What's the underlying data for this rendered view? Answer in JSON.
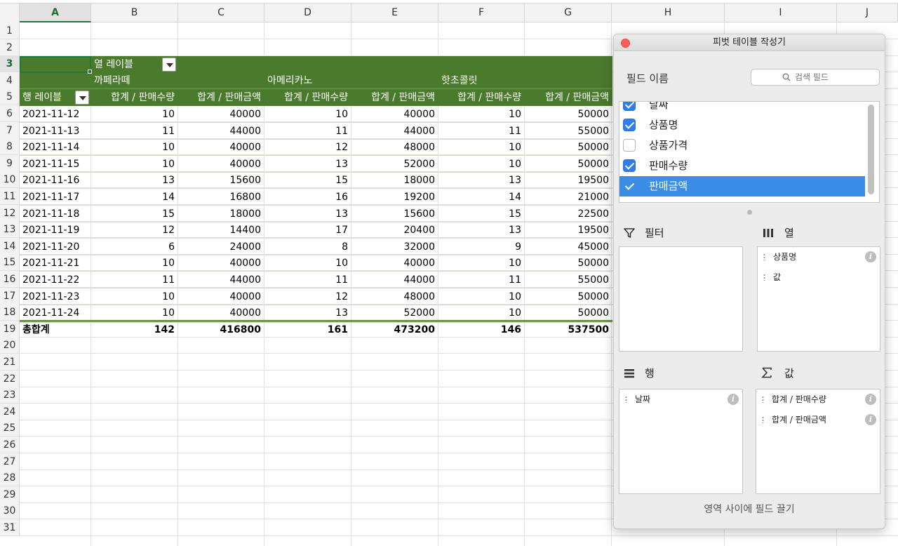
{
  "sheet": {
    "columns": [
      "A",
      "B",
      "C",
      "D",
      "E",
      "F",
      "G",
      "H",
      "I",
      "J"
    ],
    "selected_column": "A",
    "rows": [
      "1",
      "2",
      "3",
      "4",
      "5",
      "6",
      "7",
      "8",
      "9",
      "10",
      "11",
      "12",
      "13",
      "14",
      "15",
      "16",
      "17",
      "18",
      "19",
      "20",
      "21",
      "22",
      "23",
      "24",
      "25",
      "26",
      "27",
      "28",
      "29",
      "30",
      "31"
    ],
    "selected_row": "3"
  },
  "pivot": {
    "col_label": "열 레이블",
    "row_label": "행 레이블",
    "products": [
      "까페라떼",
      "아메리카노",
      "핫초콜릿"
    ],
    "value_headers": [
      "합계 / 판매수량",
      "합계 / 판매금액",
      "합계 / 판매수량",
      "합계 / 판매금액",
      "합계 / 판매수량",
      "합계 / 판매금액"
    ],
    "rows": [
      {
        "date": "2021-11-12",
        "v": [
          "10",
          "40000",
          "10",
          "40000",
          "10",
          "50000"
        ]
      },
      {
        "date": "2021-11-13",
        "v": [
          "11",
          "44000",
          "11",
          "44000",
          "11",
          "55000"
        ]
      },
      {
        "date": "2021-11-14",
        "v": [
          "10",
          "40000",
          "12",
          "48000",
          "10",
          "50000"
        ]
      },
      {
        "date": "2021-11-15",
        "v": [
          "10",
          "40000",
          "13",
          "52000",
          "10",
          "50000"
        ]
      },
      {
        "date": "2021-11-16",
        "v": [
          "13",
          "15600",
          "15",
          "18000",
          "13",
          "19500"
        ]
      },
      {
        "date": "2021-11-17",
        "v": [
          "14",
          "16800",
          "16",
          "19200",
          "14",
          "21000"
        ]
      },
      {
        "date": "2021-11-18",
        "v": [
          "15",
          "18000",
          "13",
          "15600",
          "15",
          "22500"
        ]
      },
      {
        "date": "2021-11-19",
        "v": [
          "12",
          "14400",
          "17",
          "20400",
          "13",
          "19500"
        ]
      },
      {
        "date": "2021-11-20",
        "v": [
          "6",
          "24000",
          "8",
          "32000",
          "9",
          "45000"
        ]
      },
      {
        "date": "2021-11-21",
        "v": [
          "10",
          "40000",
          "10",
          "40000",
          "10",
          "50000"
        ]
      },
      {
        "date": "2021-11-22",
        "v": [
          "11",
          "44000",
          "11",
          "44000",
          "11",
          "55000"
        ]
      },
      {
        "date": "2021-11-23",
        "v": [
          "10",
          "40000",
          "12",
          "48000",
          "10",
          "50000"
        ]
      },
      {
        "date": "2021-11-24",
        "v": [
          "10",
          "40000",
          "13",
          "52000",
          "10",
          "50000"
        ]
      }
    ],
    "total": {
      "label": "총합계",
      "v": [
        "142",
        "416800",
        "161",
        "473200",
        "146",
        "537500"
      ]
    }
  },
  "panel": {
    "title": "피벗 테이블 작성기",
    "field_name_label": "필드 이름",
    "search_placeholder": "검색 필드",
    "fields": [
      {
        "label": "날짜",
        "checked": true,
        "selected": false
      },
      {
        "label": "상품명",
        "checked": true,
        "selected": false
      },
      {
        "label": "상품가격",
        "checked": false,
        "selected": false
      },
      {
        "label": "판매수량",
        "checked": true,
        "selected": false
      },
      {
        "label": "판매금액",
        "checked": true,
        "selected": true
      }
    ],
    "filter_label": "필터",
    "columns_label": "열",
    "rows_label": "행",
    "values_label": "값",
    "columns_items": [
      "상품명",
      "값"
    ],
    "rows_items": [
      "날짜"
    ],
    "values_items": [
      "합계 / 판매수량",
      "합계 / 판매금액"
    ],
    "footer_hint": "영역 사이에 필드 끌기"
  },
  "colors": {
    "pivot_header": "#4a7a2c",
    "selection": "#1e7a3a",
    "list_selection": "#3a8ee6",
    "checkbox_on": "#2f7df6",
    "close_button": "#fc5d57"
  }
}
